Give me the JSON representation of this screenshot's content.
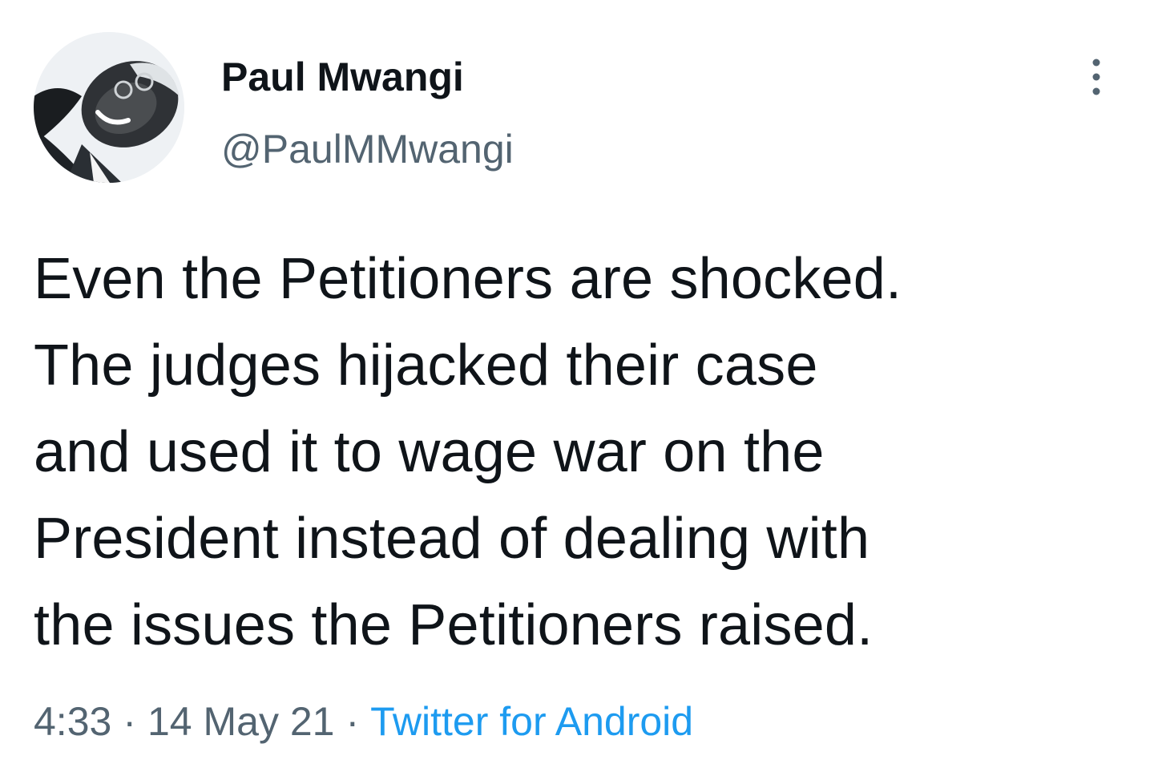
{
  "tweet": {
    "author": {
      "display_name": "Paul Mwangi",
      "handle": "@PaulMMwangi",
      "avatar_icon": "profile-photo-icon"
    },
    "menu_icon": "more-vertical-icon",
    "text": "Even the Petitioners are shocked.\nThe judges hijacked their case\nand used it to wage war on the\nPresident instead of dealing with\nthe issues the Petitioners raised.",
    "time": "4:33",
    "date": "14 May 21",
    "separator": "·",
    "source": "Twitter for Android"
  },
  "colors": {
    "text_primary": "#0f1419",
    "text_secondary": "#536471",
    "link": "#1d9bf0",
    "background": "#ffffff"
  }
}
